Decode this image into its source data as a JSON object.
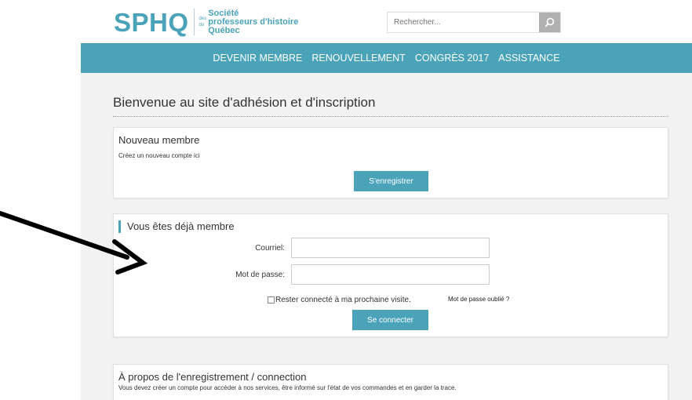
{
  "header": {
    "logo_mark": "SPHQ",
    "logo_small_top": "des",
    "logo_small_bottom": "du",
    "logo_line1": "Société",
    "logo_line2": "professeurs d'histoire",
    "logo_line3": "Québec",
    "search_placeholder": "Rechercher...",
    "search_icon": "search-icon"
  },
  "nav": {
    "items": [
      "DEVENIR MEMBRE",
      "RENOUVELLEMENT",
      "CONGRÈS 2017",
      "ASSISTANCE"
    ]
  },
  "main": {
    "welcome": "Bienvenue au site d'adhésion et d'inscription",
    "new_member": {
      "title": "Nouveau membre",
      "subtitle": "Créez un nouveau compte ici",
      "button": "S'enregistrer"
    },
    "login": {
      "title": "Vous êtes déjà membre",
      "email_label": "Courriel:",
      "password_label": "Mot de passe:",
      "email_value": "",
      "password_value": "",
      "remember_label": "Rester connecté à ma prochaine visite.",
      "forgot_link": "Mot de passe oublié ?",
      "button": "Se connecter"
    },
    "about": {
      "title": "À propos de l'enregistrement / connection",
      "text": "Vous devez créer un compte pour accéder à nos services, être informé sur l'état de vos commandes et en garder la trace."
    }
  },
  "colors": {
    "accent": "#4aa3b8",
    "page_bg": "#f2f2f2"
  }
}
